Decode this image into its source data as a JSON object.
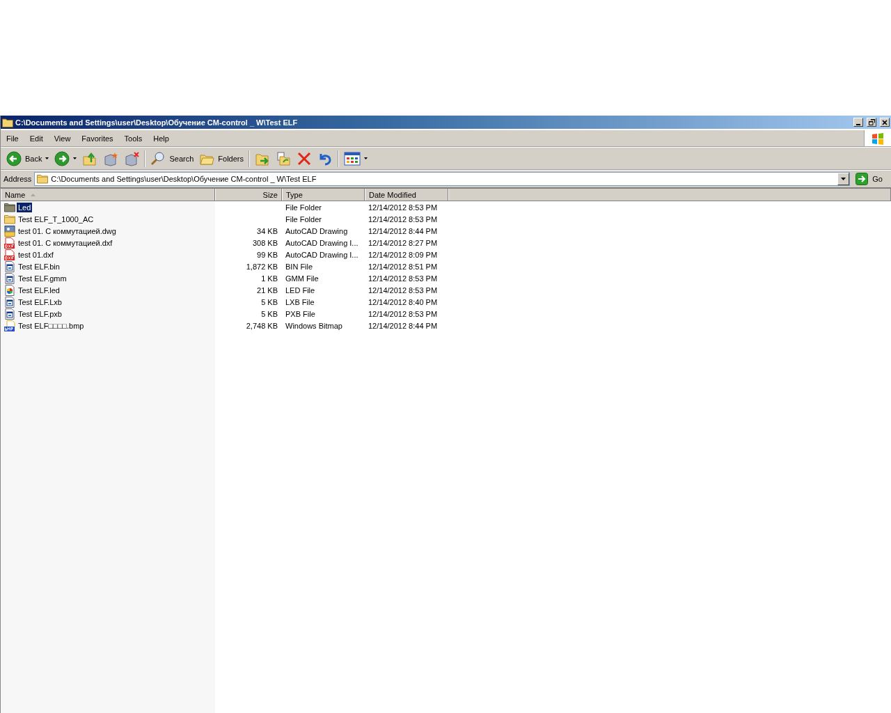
{
  "window": {
    "title": "C:\\Documents and Settings\\user\\Desktop\\Обучение CM-control _ W\\Test ELF"
  },
  "menu": [
    "File",
    "Edit",
    "View",
    "Favorites",
    "Tools",
    "Help"
  ],
  "toolbar": [
    {
      "kind": "back",
      "label": "Back",
      "dropdown": true
    },
    {
      "kind": "forward",
      "dropdown": true
    },
    {
      "kind": "up"
    },
    {
      "kind": "newbox"
    },
    {
      "kind": "delbox"
    },
    {
      "kind": "sep"
    },
    {
      "kind": "search",
      "label": "Search"
    },
    {
      "kind": "folders",
      "label": "Folders"
    },
    {
      "kind": "sep"
    },
    {
      "kind": "move"
    },
    {
      "kind": "copy"
    },
    {
      "kind": "delete"
    },
    {
      "kind": "undo"
    },
    {
      "kind": "sep"
    },
    {
      "kind": "views",
      "dropdown": true
    }
  ],
  "address": {
    "label": "Address",
    "value": "C:\\Documents and Settings\\user\\Desktop\\Обучение CM-control _ W\\Test ELF",
    "go": "Go"
  },
  "columns": [
    {
      "label": "Name",
      "sorted": true
    },
    {
      "label": "Size",
      "sorted": false
    },
    {
      "label": "Type",
      "sorted": false
    },
    {
      "label": "Date Modified",
      "sorted": false
    }
  ],
  "rows": [
    {
      "kind": "folder",
      "name": "Led",
      "size": "",
      "type": "File Folder",
      "date": "12/14/2012 8:53 PM",
      "selected": true
    },
    {
      "kind": "folder",
      "name": "Test ELF_T_1000_AC",
      "size": "",
      "type": "File Folder",
      "date": "12/14/2012 8:53 PM",
      "selected": false
    },
    {
      "kind": "dwg",
      "name": "test 01. С коммутацией.dwg",
      "size": "34 KB",
      "type": "AutoCAD Drawing",
      "date": "12/14/2012 8:44 PM",
      "selected": false
    },
    {
      "kind": "dxf",
      "name": "test 01. С коммутацией.dxf",
      "size": "308 KB",
      "type": "AutoCAD Drawing I...",
      "date": "12/14/2012 8:27 PM",
      "selected": false
    },
    {
      "kind": "dxf",
      "name": "test 01.dxf",
      "size": "99 KB",
      "type": "AutoCAD Drawing I...",
      "date": "12/14/2012 8:09 PM",
      "selected": false
    },
    {
      "kind": "generic",
      "name": "Test ELF.bin",
      "size": "1,872 KB",
      "type": "BIN File",
      "date": "12/14/2012 8:51 PM",
      "selected": false
    },
    {
      "kind": "generic",
      "name": "Test ELF.gmm",
      "size": "1 KB",
      "type": "GMM File",
      "date": "12/14/2012 8:53 PM",
      "selected": false
    },
    {
      "kind": "color",
      "name": "Test ELF.led",
      "size": "21 KB",
      "type": "LED File",
      "date": "12/14/2012 8:53 PM",
      "selected": false
    },
    {
      "kind": "generic",
      "name": "Test ELF.Lxb",
      "size": "5 KB",
      "type": "LXB File",
      "date": "12/14/2012 8:40 PM",
      "selected": false
    },
    {
      "kind": "generic",
      "name": "Test ELF.pxb",
      "size": "5 KB",
      "type": "PXB File",
      "date": "12/14/2012 8:53 PM",
      "selected": false
    },
    {
      "kind": "bmp",
      "name": "Test ELF□□□□.bmp",
      "size": "2,748 KB",
      "type": "Windows Bitmap",
      "date": "12/14/2012 8:44 PM",
      "selected": false
    }
  ]
}
